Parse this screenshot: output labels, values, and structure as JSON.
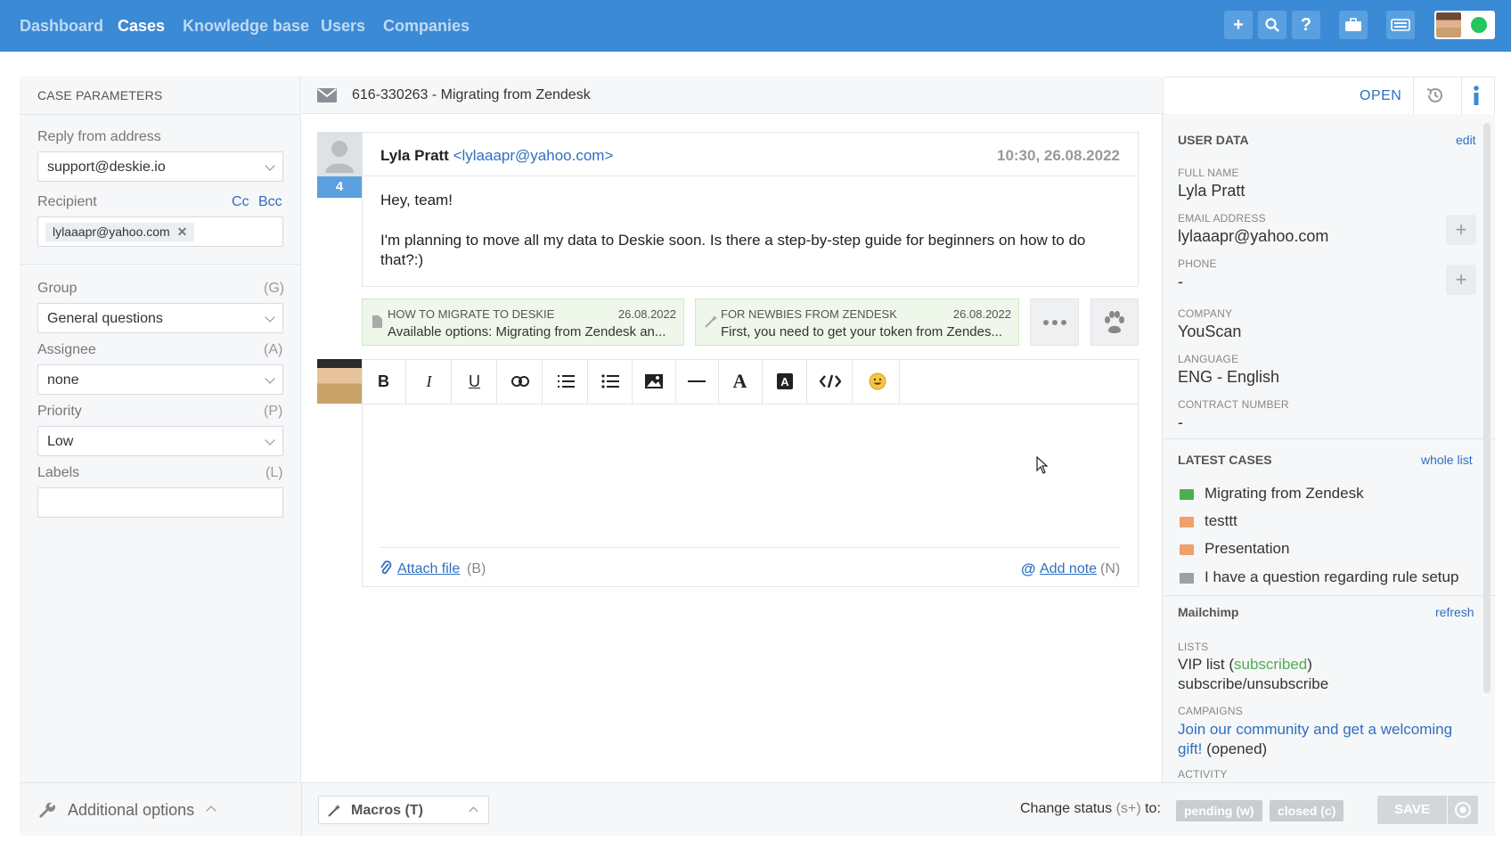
{
  "nav": {
    "items": [
      "Dashboard",
      "Cases",
      "Knowledge base",
      "Users",
      "Companies"
    ],
    "active": "Cases"
  },
  "left": {
    "title": "CASE PARAMETERS",
    "reply_label": "Reply from address",
    "reply_value": "support@deskie.io",
    "recipient_label": "Recipient",
    "cc": "Cc",
    "bcc": "Bcc",
    "recipient_chip": "lylaaapr@yahoo.com",
    "group_label": "Group",
    "group_key": "(G)",
    "group_value": "General questions",
    "assignee_label": "Assignee",
    "assignee_key": "(A)",
    "assignee_value": "none",
    "priority_label": "Priority",
    "priority_key": "(P)",
    "priority_value": "Low",
    "labels_label": "Labels",
    "labels_key": "(L)",
    "additional_options": "Additional options"
  },
  "center": {
    "case_title": "616-330263 - Migrating from Zendesk",
    "status": "OPEN",
    "message_count": "4",
    "sender_name": "Lyla Pratt",
    "sender_email": "<lylaaapr@yahoo.com>",
    "time": "10:30, 26.08.2022",
    "greeting": "Hey, team!",
    "body": "I'm planning to move all my data to Deskie soon. Is there a step-by-step guide for beginners on how to do that?:)",
    "kb_cards": [
      {
        "title": "HOW TO MIGRATE TO DESKIE",
        "date": "26.08.2022",
        "text": "Available options: Migrating from Zendesk an..."
      },
      {
        "title": "FOR NEWBIES FROM ZENDESK",
        "date": "26.08.2022",
        "text": "First, you need to get your token from Zendes..."
      }
    ],
    "attach_file": "Attach file",
    "attach_key": "(B)",
    "add_note": "Add note",
    "add_note_key": "(N)"
  },
  "right": {
    "user_data": "USER DATA",
    "edit": "edit",
    "full_name_label": "FULL NAME",
    "full_name": "Lyla Pratt",
    "email_label": "EMAIL ADDRESS",
    "email": "lylaaapr@yahoo.com",
    "phone_label": "PHONE",
    "phone": "-",
    "company_label": "COMPANY",
    "company": "YouScan",
    "language_label": "LANGUAGE",
    "language": "ENG - English",
    "contract_label": "CONTRACT NUMBER",
    "contract": "-",
    "latest_cases": "LATEST CASES",
    "whole_list": "whole list",
    "cases": [
      {
        "title": "Migrating from Zendesk",
        "color": "#4caf50"
      },
      {
        "title": "testtt",
        "color": "#f0a06b"
      },
      {
        "title": "Presentation",
        "color": "#f0a06b"
      },
      {
        "title": "I have a question regarding rule setup",
        "color": "#9aa0a6"
      }
    ],
    "mailchimp": "Mailchimp",
    "refresh": "refresh",
    "lists_label": "LISTS",
    "vip_list": "VIP list",
    "subscribed": "subscribed",
    "subscribe_link": "subscribe/unsubscribe",
    "campaigns_label": "CAMPAIGNS",
    "campaign_text": "Join our community and get a welcoming gift!",
    "campaign_status": "(opened)",
    "activity_label": "ACTIVITY"
  },
  "bottom": {
    "macros": "Macros (T)",
    "change_status": "Change status",
    "change_status_key": "(s+)",
    "to": "to:",
    "pending": "pending (w)",
    "closed": "closed (c)",
    "save": "SAVE"
  },
  "colors": {
    "nav_bg": "#3a8ad6",
    "link": "#2f6fbf",
    "kb_bg": "#eef7ea",
    "badge": "#5aa0e0"
  }
}
